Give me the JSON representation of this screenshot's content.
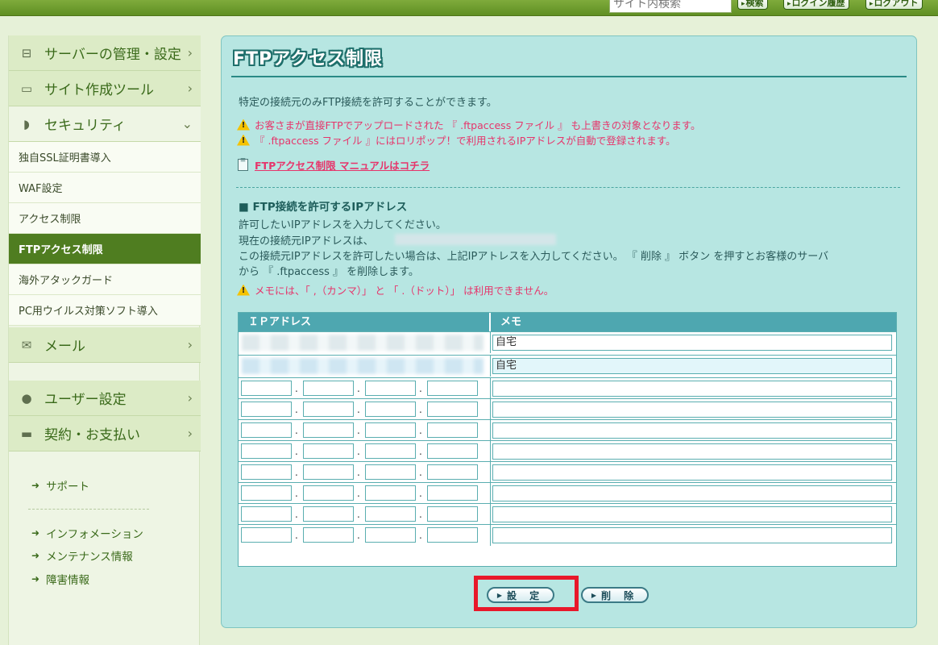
{
  "header": {
    "search_placeholder": "サイト内検索",
    "search_button": "検索",
    "login_history_button": "ログイン履歴",
    "logout_button": "ログアウト"
  },
  "sidebar": {
    "categories": [
      {
        "label": "サーバーの管理・設定",
        "icon": "server-icon"
      },
      {
        "label": "サイト作成ツール",
        "icon": "laptop-icon"
      },
      {
        "label": "セキュリティ",
        "icon": "shield-icon"
      },
      {
        "label": "メール",
        "icon": "mail-icon"
      },
      {
        "label": "ユーザー設定",
        "icon": "user-icon"
      },
      {
        "label": "契約・お支払い",
        "icon": "card-icon"
      }
    ],
    "security_items": [
      "独自SSL証明書導入",
      "WAF設定",
      "アクセス制限",
      "FTPアクセス制限",
      "海外アタックガード",
      "PC用ウイルス対策ソフト導入"
    ],
    "active_item": "FTPアクセス制限",
    "links": [
      "サポート",
      "インフォメーション",
      "メンテナンス情報",
      "障害情報"
    ]
  },
  "main": {
    "title": "FTPアクセス制限",
    "intro": "特定の接続元のみFTP接続を許可することができます。",
    "warnings": [
      "お客さまが直接FTPでアップロードされた 『 .ftpaccess ファイル 』 も上書きの対象となります。",
      "『 .ftpaccess ファイル 』にはロリポップ！で利用されるIPアドレスが自動で登録されます。"
    ],
    "manual_link": "FTPアクセス制限 マニュアルはコチラ",
    "section_title": "■ FTP接続を許可するIPアドレス",
    "instructions": [
      "許可したいIPアドレスを入力してください。",
      "現在の接続元IPアドレスは、",
      "この接続元IPアドレスを許可したい場合は、上記IPアトレスを入力してください。 『 削除 』 ボタン を押すとお客様のサーバ",
      "から 『 .ftpaccess 』 を削除します。"
    ],
    "memo_warning": "メモには、「 ,（カンマ）」 と 「 .（ドット）」 は利用できません。",
    "table": {
      "headers": [
        "ＩＰアドレス",
        "メモ"
      ],
      "rows": [
        {
          "memo": "自宅"
        },
        {
          "memo": "自宅"
        },
        {
          "memo": ""
        },
        {
          "memo": ""
        },
        {
          "memo": ""
        },
        {
          "memo": ""
        },
        {
          "memo": ""
        },
        {
          "memo": ""
        },
        {
          "memo": ""
        },
        {
          "memo": ""
        }
      ]
    },
    "set_button": "設 定",
    "delete_button": "削 除"
  },
  "colors": {
    "accent": "#4f7d20",
    "warning": "#e6356b",
    "panel": "#b7e6e2",
    "highlight": "#e8182a"
  }
}
